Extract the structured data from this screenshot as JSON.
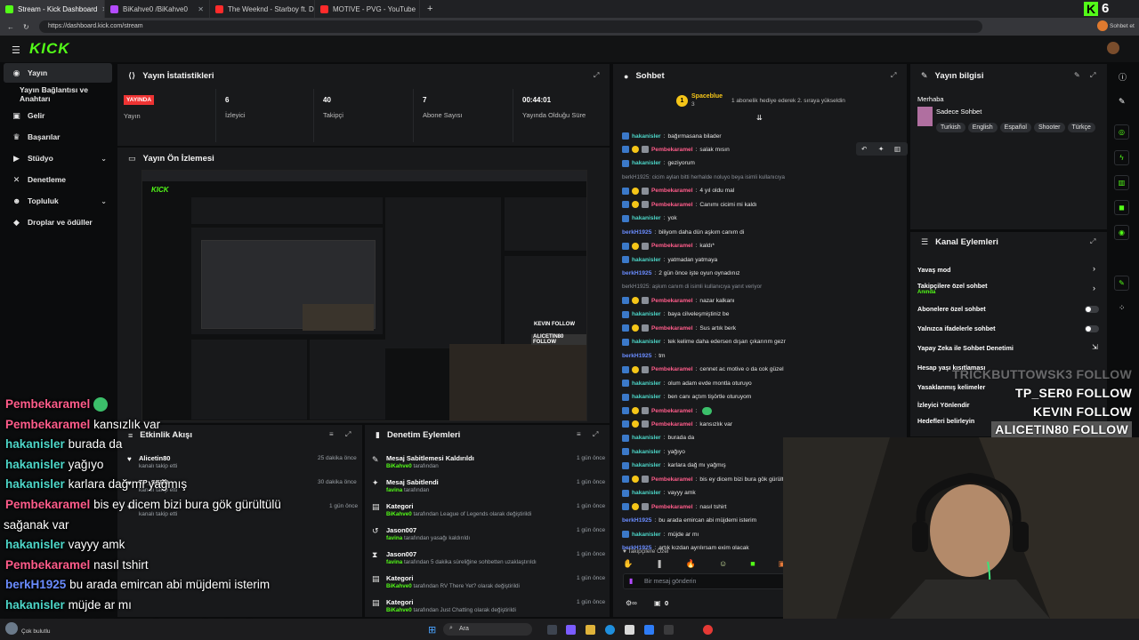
{
  "browser": {
    "tabs": [
      {
        "label": "Stream - Kick Dashboard",
        "color": "#53fc18",
        "active": true
      },
      {
        "label": "BiKahve0 /BiKahve0",
        "color": "#b44bff",
        "active": false
      },
      {
        "label": "The Weeknd - Starboy ft. Daft Pun",
        "color": "#ff2b2b",
        "active": false
      },
      {
        "label": "MOTIVE - PVG - YouTube",
        "color": "#ff2b2b",
        "active": false
      }
    ],
    "url": "https://dashboard.kick.com/stream",
    "profile_label": "Sohbet et",
    "kick_counter": "6"
  },
  "app": {
    "logo": "KICK"
  },
  "sidebar": {
    "items": [
      {
        "label": "Yayın",
        "icon": "broadcast-icon"
      },
      {
        "label": "Yayın Bağlantısı ve Anahtarı",
        "icon": ""
      },
      {
        "label": "Gelir",
        "icon": "wallet-icon"
      },
      {
        "label": "Başarılar",
        "icon": "trophy-icon"
      },
      {
        "label": "Stüdyo",
        "icon": "studio-icon"
      },
      {
        "label": "Denetleme",
        "icon": "sword-icon"
      },
      {
        "label": "Topluluk",
        "icon": "community-icon"
      },
      {
        "label": "Droplar ve ödüller",
        "icon": "drops-icon"
      }
    ]
  },
  "stats": {
    "title": "Yayın İstatistikleri",
    "live_badge": "YAYINDA",
    "live_label": "Yayın",
    "cells": [
      {
        "value": "6",
        "label": "İzleyici"
      },
      {
        "value": "40",
        "label": "Takipçi"
      },
      {
        "value": "7",
        "label": "Abone Sayısı"
      },
      {
        "value": "00:44:01",
        "label": "Yayında Olduğu Süre"
      }
    ]
  },
  "preview": {
    "title": "Yayın Ön İzlemesi"
  },
  "activity": {
    "title": "Etkinlik Akışı",
    "items": [
      {
        "name": "Alicetin80",
        "sub": "kanalı takip etti",
        "time": "25 dakika önce"
      },
      {
        "name": "TP_SER0",
        "sub": "kanalı takip etti",
        "time": "30 dakika önce"
      },
      {
        "name": "",
        "sub": "kanalı takip etti",
        "time": "1 gün önce"
      }
    ]
  },
  "moderation": {
    "title": "Denetim Eylemleri",
    "items": [
      {
        "title": "Mesaj Sabitlemesi Kaldırıldı",
        "actor": "BiKahve0",
        "rest": " tarafından",
        "time": "1 gün önce",
        "icon": "unpin-icon"
      },
      {
        "title": "Mesaj Sabitlendi",
        "actor": "favina",
        "rest": " tarafından",
        "time": "1 gün önce",
        "icon": "pin-icon"
      },
      {
        "title": "Kategori",
        "actor": "BiKahve0",
        "rest": " tarafından League of Legends olarak değiştirildi",
        "time": "1 gün önce",
        "icon": "category-icon"
      },
      {
        "title": "Jason007",
        "actor": "favina",
        "rest": " tarafından yasağı kaldırıldı",
        "time": "1 gün önce",
        "icon": "undo-icon"
      },
      {
        "title": "Jason007",
        "actor": "favina",
        "rest": " tarafından 5 dakika süreliğine sohbetten uzaklaştırıldı",
        "time": "1 gün önce",
        "icon": "timeout-icon"
      },
      {
        "title": "Kategori",
        "actor": "BiKahve0",
        "rest": " tarafından RV There Yet? olarak değiştirildi",
        "time": "1 gün önce",
        "icon": "category-icon"
      },
      {
        "title": "Kategori",
        "actor": "BiKahve0",
        "rest": " tarafından Just Chatting olarak değiştirildi",
        "time": "1 gün önce",
        "icon": "category-icon"
      }
    ]
  },
  "chat": {
    "title": "Sohbet",
    "pinned_user": "Spaceblue",
    "pinned_count": "3",
    "pinned_text": "1 abonelik hediye ederek 2. sıraya yükseldin",
    "input_placeholder": "Bir mesaj gönderin",
    "followers_only": "Takipçilere Özel",
    "counter": "0",
    "messages": [
      {
        "name": "hakanisler",
        "color": "cyan",
        "text": "bağırmasana bilader"
      },
      {
        "name": "Pembekaramel",
        "color": "pink",
        "text": "salak mısın"
      },
      {
        "name": "hakanisler",
        "color": "cyan",
        "text": "geziyorum"
      },
      {
        "name": "",
        "color": "sys",
        "text": "berkH1925: cicim aylan bitti herhalde noluyo beya isimli kullanıcıya yanıt veriyor"
      },
      {
        "name": "Pembekaramel",
        "color": "pink",
        "text": "4 yıl oldu mal"
      },
      {
        "name": "Pembekaramel",
        "color": "pink",
        "text": "Canımı cicimi mi kaldı"
      },
      {
        "name": "hakanisler",
        "color": "cyan",
        "text": "yok"
      },
      {
        "name": "berkH1925",
        "color": "blue",
        "text": "biliyom daha dün aşkım canım di"
      },
      {
        "name": "Pembekaramel",
        "color": "pink",
        "text": "kaldı*"
      },
      {
        "name": "hakanisler",
        "color": "cyan",
        "text": "yatmadan yatmaya"
      },
      {
        "name": "berkH1925",
        "color": "blue",
        "text": "2 gün önce işte oyun oynadınız"
      },
      {
        "name": "",
        "color": "sys",
        "text": "berkH1925: aşkım canım di isimli kullanıcıya yanıt veriyor"
      },
      {
        "name": "Pembekaramel",
        "color": "pink",
        "text": "nazar kalkanı"
      },
      {
        "name": "hakanisler",
        "color": "cyan",
        "text": "baya cilveleşmiştiniz be"
      },
      {
        "name": "Pembekaramel",
        "color": "pink",
        "text": "Sus artık berk"
      },
      {
        "name": "hakanisler",
        "color": "cyan",
        "text": "tek kelime daha edersen dışarı çıkarırım gezmeye"
      },
      {
        "name": "berkH1925",
        "color": "blue",
        "text": "tm"
      },
      {
        "name": "Pembekaramel",
        "color": "pink",
        "text": "cennet ac motive o da cok güzel"
      },
      {
        "name": "hakanisler",
        "color": "cyan",
        "text": "olum adam evde montla oturuyo"
      },
      {
        "name": "hakanisler",
        "color": "cyan",
        "text": "ben canı açtım tişörtle oturuyom"
      },
      {
        "name": "Pembekaramel",
        "color": "pink",
        "text": ""
      },
      {
        "name": "Pembekaramel",
        "color": "pink",
        "text": "kansızlık var"
      },
      {
        "name": "hakanisler",
        "color": "cyan",
        "text": "burada da"
      },
      {
        "name": "hakanisler",
        "color": "cyan",
        "text": "yağıyo"
      },
      {
        "name": "hakanisler",
        "color": "cyan",
        "text": "karlara dağ mı yağmış"
      },
      {
        "name": "Pembekaramel",
        "color": "pink",
        "text": "bis ey dicem bizi bura gök gürült"
      },
      {
        "name": "hakanisler",
        "color": "cyan",
        "text": "vayyy amk"
      },
      {
        "name": "Pembekaramel",
        "color": "pink",
        "text": "nasıl tshirt"
      },
      {
        "name": "berkH1925",
        "color": "blue",
        "text": "bu arada emircan abi müjdemi isterim"
      },
      {
        "name": "hakanisler",
        "color": "cyan",
        "text": "müjde ar mı"
      },
      {
        "name": "berkH1925",
        "color": "blue",
        "text": "artık kızdan ayrılırsam exim olacak"
      }
    ]
  },
  "stream_info": {
    "title": "Yayın bilgisi",
    "greeting": "Merhaba",
    "category": "Sadece Sohbet",
    "tags": [
      "Turkish",
      "English",
      "Español",
      "Shooter",
      "Türkçe"
    ]
  },
  "channel_actions": {
    "title": "Kanal Eylemleri",
    "rows": [
      {
        "label": "Yavaş mod",
        "sub": "",
        "control": "chevron"
      },
      {
        "label": "Takipçilere özel sohbet",
        "sub": "Anında",
        "control": "chevron"
      },
      {
        "label": "Abonelere özel sohbet",
        "sub": "",
        "control": "toggle"
      },
      {
        "label": "Yalnızca ifadelerle sohbet",
        "sub": "",
        "control": "toggle"
      },
      {
        "label": "Yapay Zeka ile Sohbet Denetimi",
        "sub": "",
        "control": "link"
      },
      {
        "label": "Hesap yaşı kısıtlaması",
        "sub": "",
        "control": "chevron"
      },
      {
        "label": "Yasaklanmış kelimeler",
        "sub": "",
        "control": "chevron"
      },
      {
        "label": "İzleyici Yönlendir",
        "sub": "",
        "control": ""
      },
      {
        "label": "Hedefleri belirleyin",
        "sub": "",
        "control": ""
      }
    ]
  },
  "overlay_chat": [
    {
      "name": "Pembekaramel",
      "color": "pink",
      "text": ""
    },
    {
      "name": "Pembekaramel",
      "color": "pink",
      "text": "kansızlık var"
    },
    {
      "name": "hakanisler",
      "color": "cyan",
      "text": "burada da"
    },
    {
      "name": "hakanisler",
      "color": "cyan",
      "text": "yağıyo"
    },
    {
      "name": "hakanisler",
      "color": "cyan",
      "text": "karlara dağ mı yağmış"
    },
    {
      "name": "Pembekaramel",
      "color": "pink",
      "text": "bis ey dicem bizi bura gök gürültülü"
    },
    {
      "name": "",
      "color": "none",
      "text": "sağanak var"
    },
    {
      "name": "hakanisler",
      "color": "cyan",
      "text": "vayyy amk"
    },
    {
      "name": "Pembekaramel",
      "color": "pink",
      "text": "nasıl tshirt"
    },
    {
      "name": "berkH1925",
      "color": "blue",
      "text": "bu arada emircan abi müjdemi isterim"
    },
    {
      "name": "hakanisler",
      "color": "cyan",
      "text": "müjde ar mı"
    },
    {
      "name": "berkH1925",
      "color": "blue",
      "text": "artık kızdan ayrılırsam exim olacak"
    }
  ],
  "follow_overlay": [
    {
      "name": "TRICKBUTTOWSK3",
      "action": "FOLLOW",
      "faded": true
    },
    {
      "name": "TP_SER0",
      "action": "FOLLOW",
      "faded": false
    },
    {
      "name": "KEVIN",
      "action": "FOLLOW",
      "faded": false
    },
    {
      "name": "ALICETIN80",
      "action": "FOLLOW",
      "faded": false
    }
  ],
  "taskbar": {
    "search_placeholder": "Ara",
    "weather": "Çok bulutlu"
  },
  "colors": {
    "accent": "#53fc18",
    "pink": "#ff5c8a",
    "cyan": "#4dd6c8",
    "blue": "#6a8cff",
    "live": "#e33333"
  }
}
